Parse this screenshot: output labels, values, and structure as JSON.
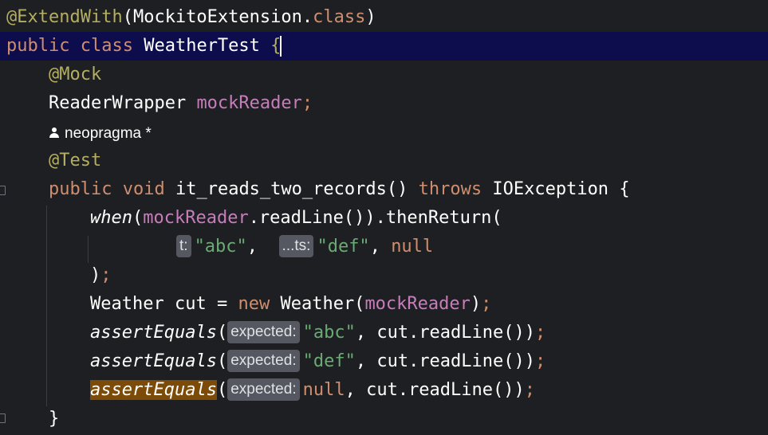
{
  "editor": {
    "language": "Java",
    "lines": {
      "l1": {
        "annotation": "@ExtendWith",
        "open": "(",
        "cls": "MockitoExtension",
        "dot": ".",
        "kw": "class",
        "close": ")"
      },
      "l2": {
        "kw1": "public",
        "kw2": "class",
        "name": "WeatherTest",
        "brace": "{"
      },
      "l3": {
        "annotation": "@Mock"
      },
      "l4": {
        "type": "ReaderWrapper",
        "field": "mockReader",
        "semi": ";"
      },
      "author": {
        "name": "neopragma",
        "marker": "*"
      },
      "l5": {
        "annotation": "@Test"
      },
      "l6": {
        "kw1": "public",
        "kw2": "void",
        "method": "it_reads_two_records",
        "parens": "()",
        "throws": "throws",
        "exception": "IOException",
        "brace": "{"
      },
      "l7": {
        "fn": "when",
        "open": "(",
        "field": "mockReader",
        "call": ".readLine()).thenReturn("
      },
      "l8": {
        "hint1": "t:",
        "str1": "\"abc\"",
        "comma": ",",
        "hint2": "...ts:",
        "str2": "\"def\"",
        "comma2": ",",
        "null": "null"
      },
      "l9": {
        "close": ")",
        "semi": ";"
      },
      "l10": {
        "type": "Weather",
        "var": "cut",
        "eq": "=",
        "kw": "new",
        "ctor": "Weather(",
        "field": "mockReader",
        "close": ")",
        "semi": ";"
      },
      "l11": {
        "fn": "assertEquals",
        "open": "(",
        "hint": "expected:",
        "str": "\"abc\"",
        "rest": ", cut.readLine())",
        "semi": ";"
      },
      "l12": {
        "fn": "assertEquals",
        "open": "(",
        "hint": "expected:",
        "str": "\"def\"",
        "rest": ", cut.readLine())",
        "semi": ";"
      },
      "l13": {
        "fn": "assertEquals",
        "open": "(",
        "hint": "expected:",
        "null": "null",
        "rest": ", cut.readLine())",
        "semi": ";"
      },
      "l14": {
        "brace": "}"
      }
    },
    "colors": {
      "background": "#1e1f22",
      "current_line": "#0d0d4e",
      "annotation": "#b3ae60",
      "keyword": "#cf8e6d",
      "string": "#6aab73",
      "field": "#c77dbb",
      "inlay_hint_bg": "#555860",
      "occurrence_highlight": "#7d4b08"
    }
  }
}
